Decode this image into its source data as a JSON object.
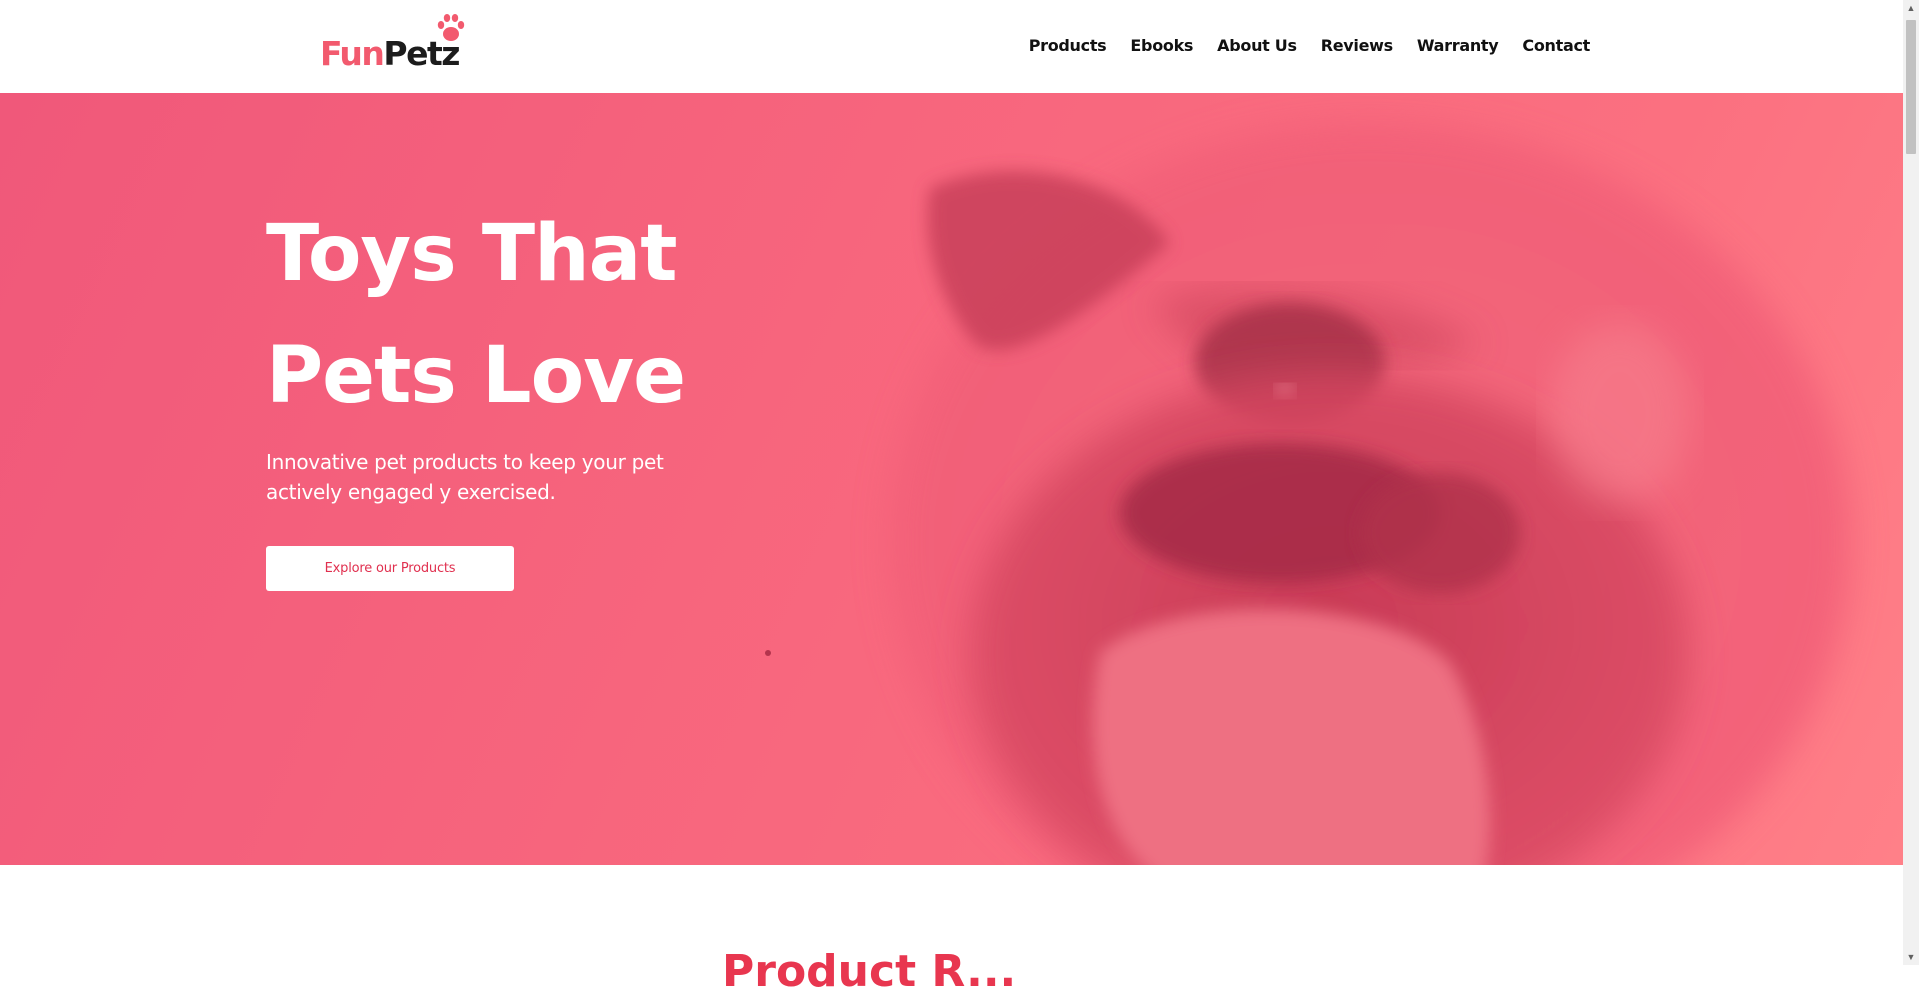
{
  "brand": {
    "name_part1": "Fun",
    "name_part2": "Petz",
    "logo_icon": "paw-icon"
  },
  "nav": {
    "items": [
      "Products",
      "Ebooks",
      "About Us",
      "Reviews",
      "Warranty",
      "Contact"
    ]
  },
  "hero": {
    "title_line1": "Toys That",
    "title_line2": "Pets Love",
    "subtitle": "Innovative pet products to keep your pet actively engaged y exercised.",
    "cta_label": "Explore our Products",
    "background_image": "pug-face-photo"
  },
  "next_section": {
    "title_partial": "Product R..."
  },
  "colors": {
    "accent": "#f25a6e",
    "hero_overlay": "#f7657d",
    "cta_text": "#e0304f",
    "text_dark": "#111111"
  }
}
